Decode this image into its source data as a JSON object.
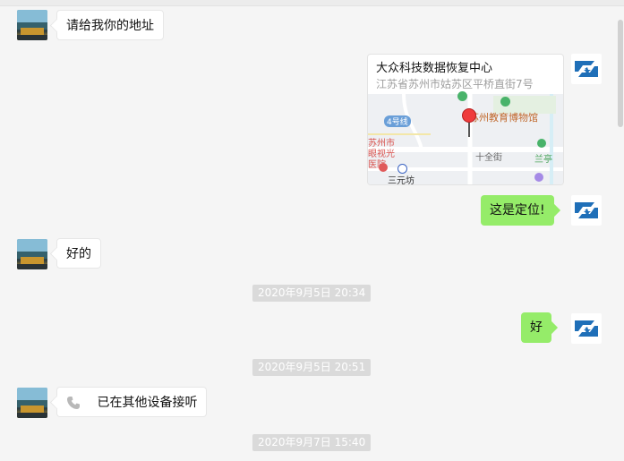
{
  "messages": {
    "m1": {
      "text": "请给我你的地址"
    },
    "location": {
      "name": "大众科技数据恢复中心",
      "address": "江苏省苏州市姑苏区平桥直街7号",
      "map_labels": {
        "road": "4号线",
        "museum": "苏州教育博物馆",
        "hospital": "苏州市眼视光医院",
        "shiquan": "十全街",
        "lanting": "兰亭",
        "sanyuanfang": "三元坊"
      }
    },
    "m2": {
      "text": "这是定位!"
    },
    "m3": {
      "text": "好的"
    },
    "m4": {
      "text": "好"
    },
    "m5": {
      "text": "已在其他设备接听",
      "icon": "phone-icon"
    }
  },
  "timestamps": {
    "t1": "2020年9月5日 20:34",
    "t2": "2020年9月5日 20:51",
    "t3": "2020年9月7日 15:40"
  },
  "colors": {
    "chat_bg": "#f5f5f5",
    "outgoing_bubble": "#95ec69",
    "incoming_bubble": "#ffffff",
    "timestamp_bg": "#dadada",
    "brand_blue": "#1f6fb8"
  }
}
